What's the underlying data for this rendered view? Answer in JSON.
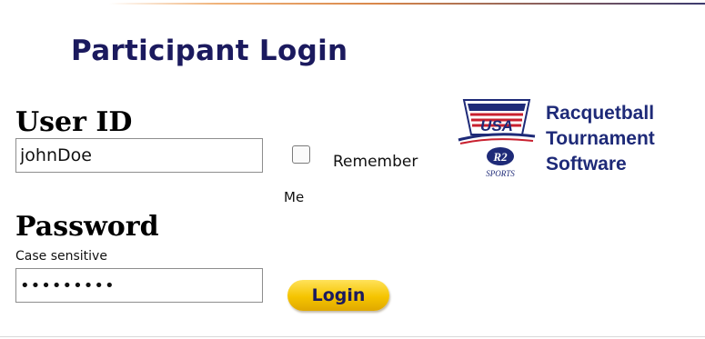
{
  "page": {
    "title": "Participant Login"
  },
  "form": {
    "user_id": {
      "label": "User ID",
      "value": "johnDoe"
    },
    "remember": {
      "label_line1": "Remember",
      "label_line2": "Me",
      "checked": false
    },
    "password": {
      "label": "Password",
      "hint": "Case sensitive",
      "value": "•••••••••"
    },
    "login_button": {
      "label": "Login"
    }
  },
  "branding": {
    "logo_text_lines": [
      "Racquetball",
      "Tournament",
      "Software"
    ],
    "logo_usa_text": "USA",
    "logo_sports_text": "SPORTS",
    "logo_r2_text": "R2",
    "colors": {
      "brand_navy": "#1b1a5e",
      "button_yellow": "#f5c400",
      "logo_red": "#c8202f"
    }
  }
}
